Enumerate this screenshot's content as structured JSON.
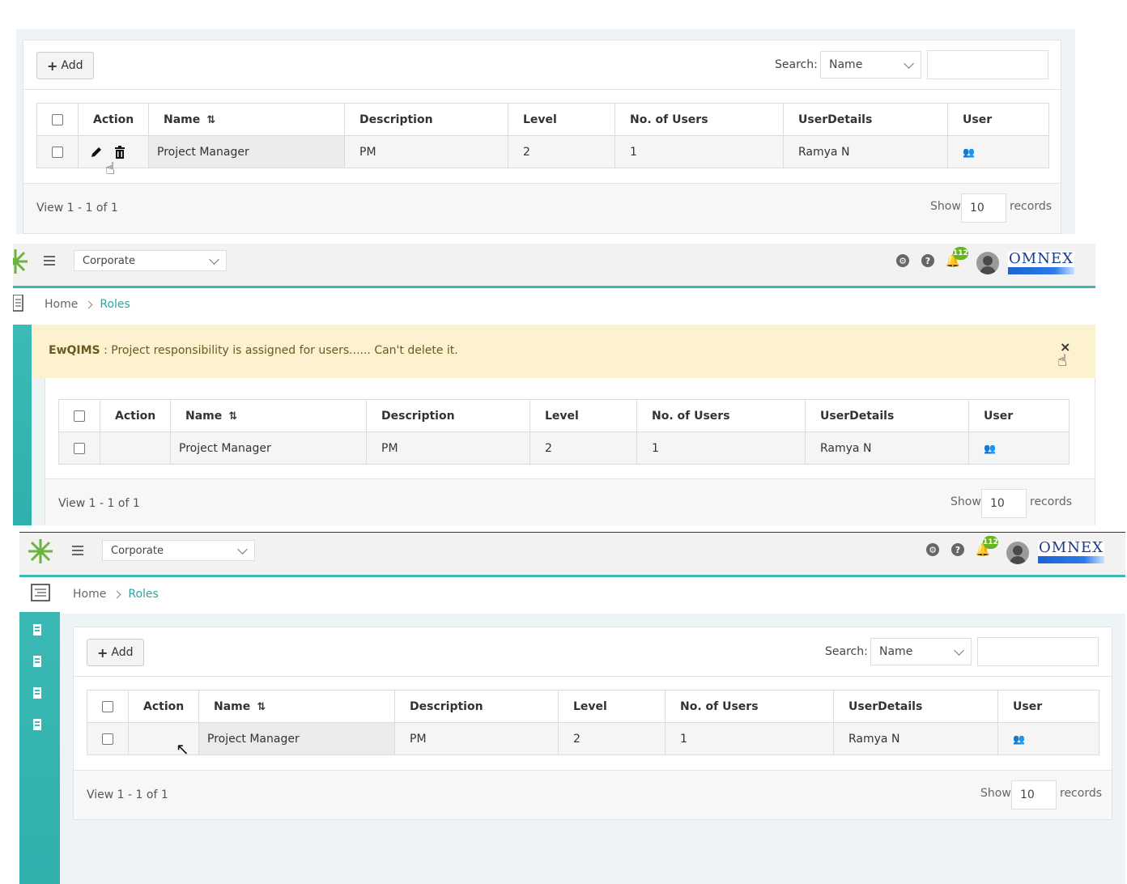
{
  "table": {
    "add_label": "Add",
    "search_label": "Search:",
    "search_field": "Name",
    "columns": [
      "Action",
      "Name",
      "Description",
      "Level",
      "No. of Users",
      "UserDetails",
      "User"
    ],
    "row": {
      "name": "Project Manager",
      "description": "PM",
      "level": "2",
      "users": "1",
      "user_details": "Ramya N"
    },
    "view_text": "View 1 - 1 of 1",
    "show_label": "Show",
    "show_value": "10",
    "records_label": "records"
  },
  "header": {
    "company_select": "Corporate",
    "notification_count": "112",
    "logo_text": "OMNEX"
  },
  "breadcrumb": {
    "home": "Home",
    "current": "Roles"
  },
  "alert": {
    "app": "EwQIMS",
    "message": " : Project responsibility is assigned for users...... Can't delete it.",
    "close": "×"
  },
  "colors": {
    "accent": "#3fb8b3",
    "alert_bg": "#fcf2cf",
    "badge": "#67b51e",
    "link": "#2aa6a1"
  },
  "icons": [
    "plus-icon",
    "chevron-down-icon",
    "sort-icon",
    "edit-icon",
    "delete-icon",
    "user-group-icon",
    "menu-icon",
    "gear-icon",
    "help-icon",
    "bell-icon",
    "avatar",
    "building-icon",
    "close-icon"
  ]
}
